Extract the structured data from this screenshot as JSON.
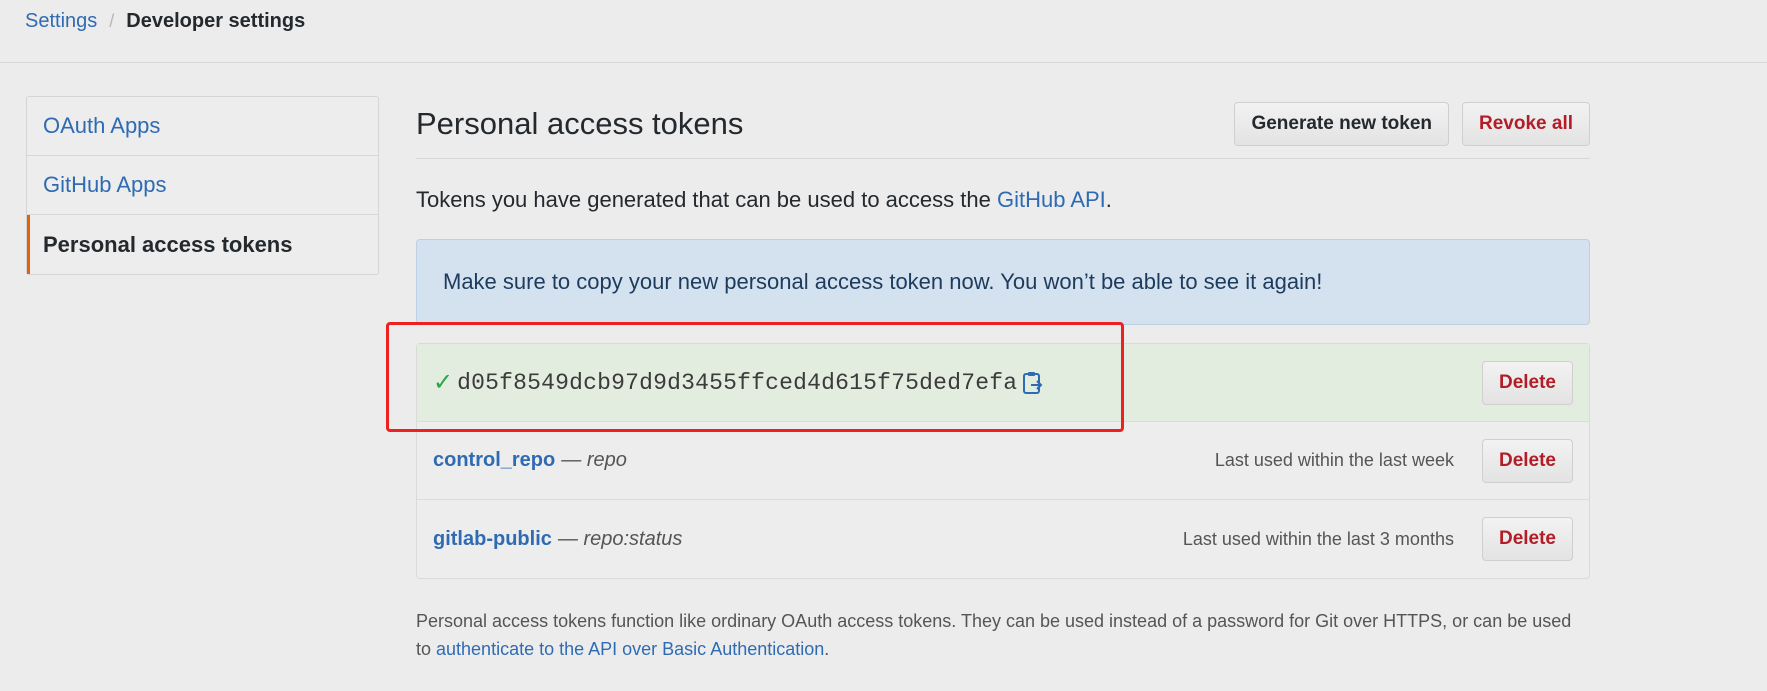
{
  "breadcrumb": {
    "root": "Settings",
    "separator": "/",
    "current": "Developer settings"
  },
  "sidebar": {
    "items": [
      {
        "label": "OAuth Apps",
        "active": false
      },
      {
        "label": "GitHub Apps",
        "active": false
      },
      {
        "label": "Personal access tokens",
        "active": true
      }
    ]
  },
  "header": {
    "title": "Personal access tokens",
    "generate_label": "Generate new token",
    "revoke_label": "Revoke all"
  },
  "description": {
    "text": "Tokens you have generated that can be used to access the ",
    "link": "GitHub API",
    "end": "."
  },
  "flash": {
    "message": "Make sure to copy your new personal access token now. You won’t be able to see it again!"
  },
  "new_token": {
    "icon": "check-icon",
    "value": "d05f8549dcb97d9d3455ffced4d615f75ded7efa",
    "copy_icon": "clipboard-icon",
    "delete_label": "Delete"
  },
  "tokens": [
    {
      "name": "control_repo",
      "dash": "—",
      "scope": "repo",
      "last_used": "Last used within the last week",
      "delete_label": "Delete"
    },
    {
      "name": "gitlab-public",
      "dash": "—",
      "scope": "repo:status",
      "last_used": "Last used within the last 3 months",
      "delete_label": "Delete"
    }
  ],
  "footer": {
    "text": "Personal access tokens function like ordinary OAuth access tokens. They can be used instead of a password for Git over HTTPS, or can be used to ",
    "link": "authenticate to the API over Basic Authentication",
    "end": "."
  },
  "colors": {
    "link": "#2f6bb3",
    "danger": "#b31d28",
    "highlight": "#ee2020",
    "success": "#28a745",
    "flash_bg": "#d4e2ef"
  }
}
